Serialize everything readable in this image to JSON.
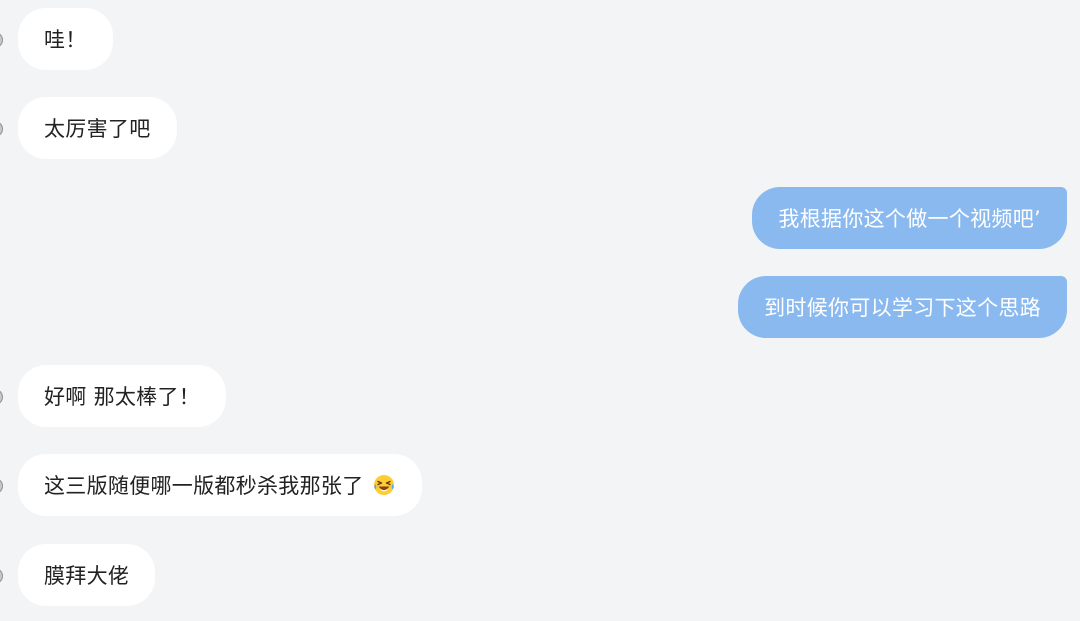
{
  "messages": [
    {
      "side": "incoming",
      "text": "哇！"
    },
    {
      "side": "incoming",
      "text": "太厉害了吧"
    },
    {
      "side": "outgoing",
      "text": "我根据你这个做一个视频吧’"
    },
    {
      "side": "outgoing",
      "text": "到时候你可以学习下这个思路"
    },
    {
      "side": "incoming",
      "text": "好啊 那太棒了！"
    },
    {
      "side": "incoming",
      "text": "这三版随便哪一版都秒杀我那张了",
      "emoji": "laughing-tears-emoji"
    },
    {
      "side": "incoming",
      "text": "膜拜大佬"
    }
  ],
  "colors": {
    "background": "#f3f4f6",
    "incoming_bubble": "#ffffff",
    "outgoing_bubble": "#8ab9ef",
    "incoming_text": "#222222",
    "outgoing_text": "#ffffff"
  }
}
